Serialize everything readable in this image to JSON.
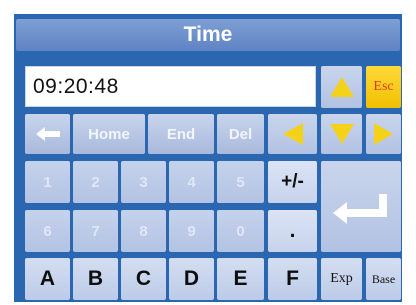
{
  "dialog": {
    "title": "Time",
    "display_value": "09:20:48"
  },
  "keys": {
    "home": "Home",
    "end": "End",
    "del": "Del",
    "esc": "Esc",
    "plus_minus": "+/-",
    "dot": ".",
    "exp": "Exp",
    "base": "Base",
    "digits": [
      "1",
      "2",
      "3",
      "4",
      "5",
      "6",
      "7",
      "8",
      "9",
      "0"
    ],
    "letters": [
      "A",
      "B",
      "C",
      "D",
      "E",
      "F"
    ]
  },
  "icons": {
    "up": "arrow-up-icon",
    "down": "arrow-down-icon",
    "left": "arrow-left-icon",
    "right": "arrow-right-icon",
    "backspace": "backspace-arrow-icon",
    "enter": "enter-icon"
  },
  "colors": {
    "frame": "#2a67b0",
    "key": "#b8c7e6",
    "arrow": "#f5d21a",
    "esc_bg": "#f5cc10",
    "esc_text": "#e23a19"
  }
}
